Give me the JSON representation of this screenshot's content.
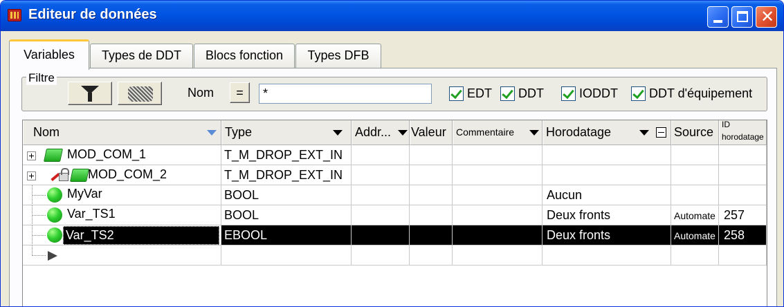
{
  "window": {
    "title": "Editeur de données"
  },
  "tabs": [
    {
      "label": "Variables",
      "active": true
    },
    {
      "label": "Types de DDT"
    },
    {
      "label": "Blocs fonction"
    },
    {
      "label": "Types DFB"
    }
  ],
  "filter": {
    "group_label": "Filtre",
    "nom_label": "Nom",
    "equals_label": "=",
    "value": "*",
    "checkboxes": [
      {
        "label": "EDT",
        "checked": true
      },
      {
        "label": "DDT",
        "checked": true
      },
      {
        "label": "IODDT",
        "checked": true
      },
      {
        "label": "DDT d'équipement",
        "checked": true
      }
    ]
  },
  "columns": [
    {
      "label": "Nom"
    },
    {
      "label": "Type"
    },
    {
      "label": "Addr..."
    },
    {
      "label": "Valeur"
    },
    {
      "label": "Commentaire"
    },
    {
      "label": "Horodatage"
    },
    {
      "label": "Source"
    },
    {
      "label_line1": "ID",
      "label_line2": "horodatage"
    }
  ],
  "rows": [
    {
      "name": "MOD_COM_1",
      "type": "T_M_DROP_EXT_IN",
      "horodatage": "",
      "source": "",
      "id": "",
      "icon": "ddt-icon"
    },
    {
      "name": "MOD_COM_2",
      "type": "T_M_DROP_EXT_IN",
      "horodatage": "",
      "source": "",
      "id": "",
      "icon": "ddt-locked-icon"
    },
    {
      "name": "MyVar",
      "type": "BOOL",
      "horodatage": "Aucun",
      "source": "",
      "id": "",
      "icon": "variable-icon"
    },
    {
      "name": "Var_TS1",
      "type": "BOOL",
      "horodatage": "Deux fronts",
      "source": "Automate",
      "id": "257",
      "icon": "variable-icon"
    },
    {
      "name": "Var_TS2",
      "type": "EBOOL",
      "horodatage": "Deux fronts",
      "source": "Automate",
      "id": "258",
      "icon": "variable-icon",
      "selected": true
    }
  ]
}
